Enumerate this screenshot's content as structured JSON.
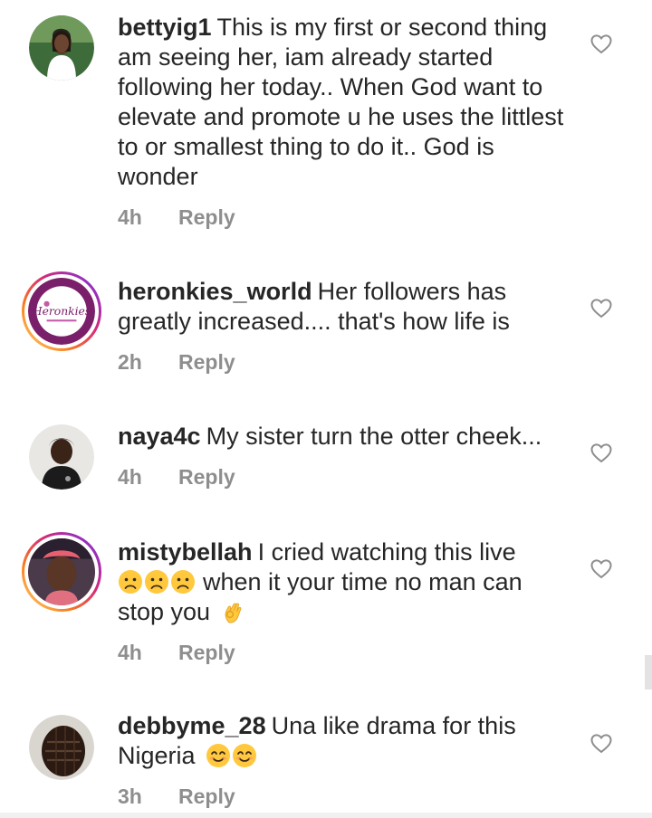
{
  "comments": [
    {
      "username": "bettyig1",
      "text": "This is my first or second thing am seeing her, iam already started following her today.. When God want to elevate and promote u he uses the littlest to or smallest thing to do it.. God is wonder",
      "time": "4h",
      "reply": "Reply"
    },
    {
      "username": "heronkies_world",
      "text": "Her followers has greatly increased.... that's how life is",
      "time": "2h",
      "reply": "Reply"
    },
    {
      "username": "naya4c",
      "text": "My sister turn the otter cheek...",
      "time": "4h",
      "reply": "Reply"
    },
    {
      "username": "mistybellah",
      "text_before": "I cried watching this live",
      "text_middle": "when it your time no man can stop you",
      "emojis_1": [
        "worried-face-emoji",
        "worried-face-emoji",
        "worried-face-emoji"
      ],
      "emojis_2": [
        "ok-hand-emoji"
      ],
      "time": "4h",
      "reply": "Reply"
    },
    {
      "username": "debbyme_28",
      "text": "Una like drama for this Nigeria",
      "emojis": [
        "smiling-face-emoji",
        "smiling-face-emoji"
      ],
      "time": "3h",
      "reply": "Reply"
    }
  ],
  "colors": {
    "text": "#262626",
    "meta": "#8e8e8e",
    "heart": "#8e8e8e",
    "emoji_yellow": "#ffc83d"
  },
  "avatar_brand_text": "Heronkies"
}
